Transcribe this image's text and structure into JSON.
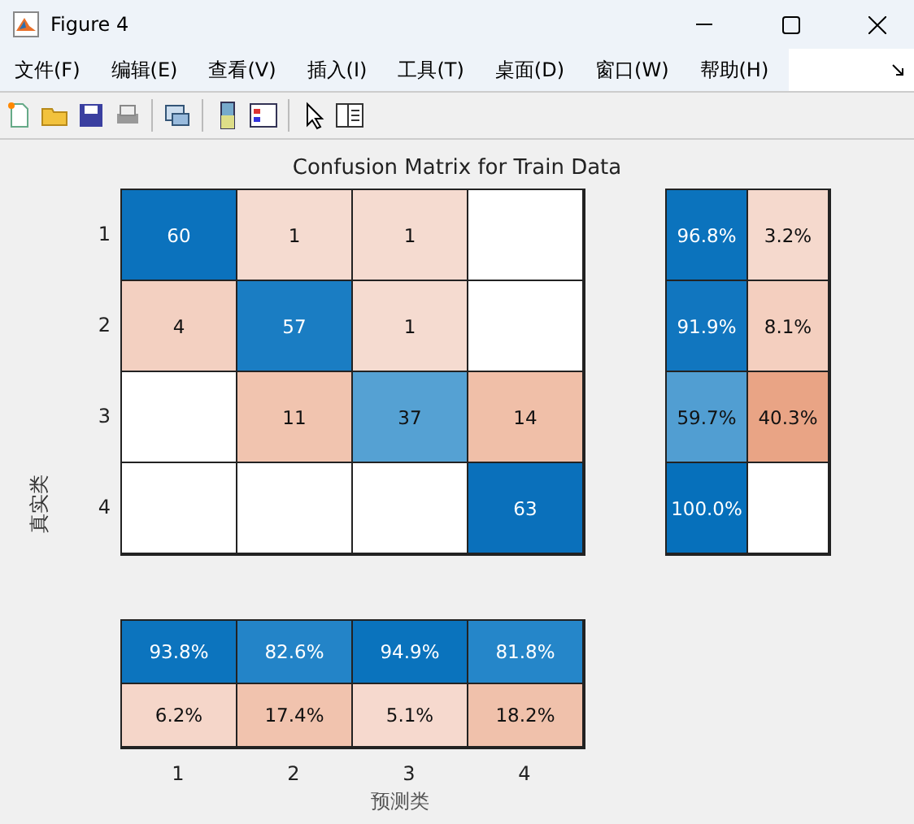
{
  "window": {
    "title": "Figure 4"
  },
  "menu": [
    "文件(F)",
    "编辑(E)",
    "查看(V)",
    "插入(I)",
    "工具(T)",
    "桌面(D)",
    "窗口(W)",
    "帮助(H)"
  ],
  "figure": {
    "title": "Confusion Matrix for Train Data",
    "ylabel": "真实类",
    "xlabel": "预测类",
    "row_labels": [
      "1",
      "2",
      "3",
      "4"
    ],
    "col_labels": [
      "1",
      "2",
      "3",
      "4"
    ],
    "matrix": [
      [
        {
          "text": "60",
          "color": "#0b72bd"
        },
        {
          "text": "1",
          "color": "#f5dbd0"
        },
        {
          "text": "1",
          "color": "#f5dbd0"
        },
        {
          "color": "#ffffff"
        }
      ],
      [
        {
          "text": "4",
          "color": "#f3d0c1"
        },
        {
          "text": "57",
          "color": "#1a7dc3"
        },
        {
          "text": "1",
          "color": "#f5dbd0"
        },
        {
          "color": "#ffffff"
        }
      ],
      [
        {
          "color": "#ffffff"
        },
        {
          "text": "11",
          "color": "#f1c4af"
        },
        {
          "text": "37",
          "color": "#55a1d3"
        },
        {
          "text": "14",
          "color": "#f0bfa8"
        }
      ],
      [
        {
          "color": "#ffffff"
        },
        {
          "color": "#ffffff"
        },
        {
          "color": "#ffffff"
        },
        {
          "text": "63",
          "color": "#0a70bb"
        }
      ]
    ],
    "row_summary": [
      [
        {
          "text": "96.8%",
          "color": "#0b73bd"
        },
        {
          "text": "3.2%",
          "color": "#f5d9cd"
        }
      ],
      [
        {
          "text": "91.9%",
          "color": "#1176bf"
        },
        {
          "text": "8.1%",
          "color": "#f4cfbf"
        }
      ],
      [
        {
          "text": "59.7%",
          "color": "#519ed2"
        },
        {
          "text": "40.3%",
          "color": "#e9a485"
        }
      ],
      [
        {
          "text": "100.0%",
          "color": "#0670bb"
        },
        {
          "color": "#ffffff"
        }
      ]
    ],
    "col_summary": [
      [
        {
          "text": "93.8%",
          "color": "#0c74be"
        },
        {
          "text": "82.6%",
          "color": "#2384c8"
        },
        {
          "text": "94.9%",
          "color": "#0a73bd"
        },
        {
          "text": "81.8%",
          "color": "#2586c9"
        }
      ],
      [
        {
          "text": "6.2%",
          "color": "#f5d6c9"
        },
        {
          "text": "17.4%",
          "color": "#f1c3ae"
        },
        {
          "text": "5.1%",
          "color": "#f6d9ce"
        },
        {
          "text": "18.2%",
          "color": "#f0c1ab"
        }
      ]
    ]
  }
}
